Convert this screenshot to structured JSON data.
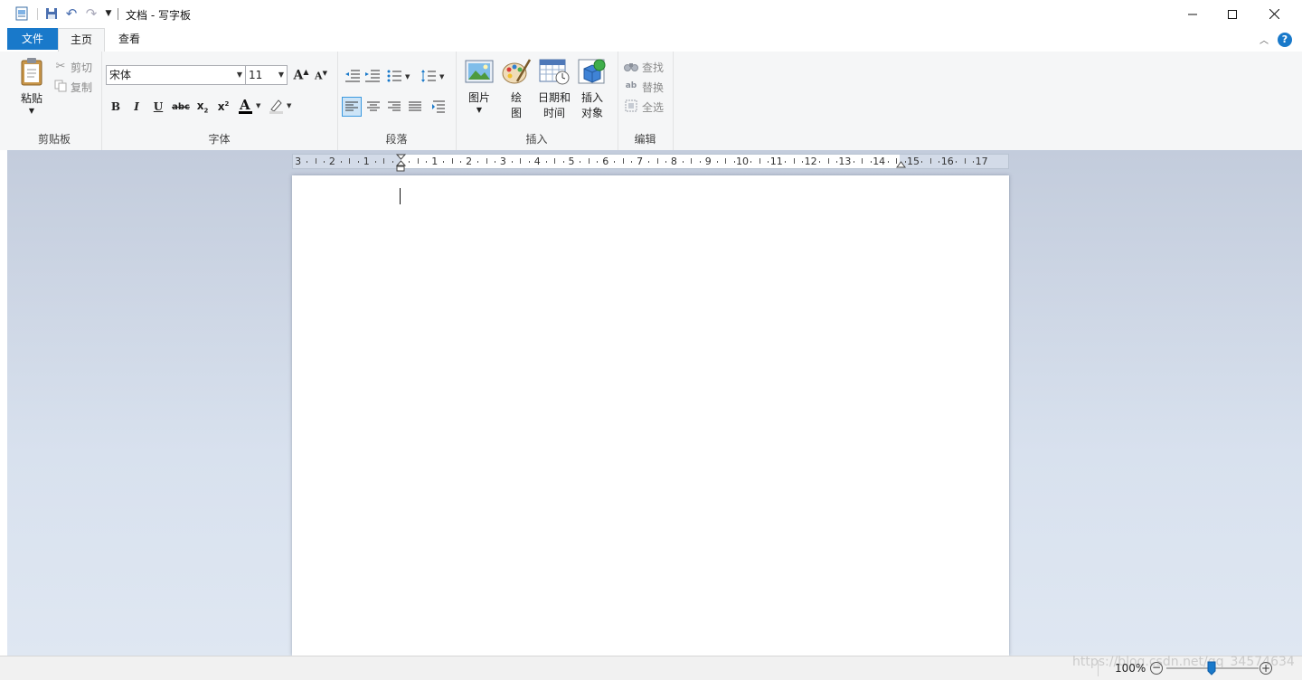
{
  "window": {
    "title": "文档 - 写字板"
  },
  "tabs": {
    "file": "文件",
    "home": "主页",
    "view": "查看"
  },
  "ribbon": {
    "clipboard": {
      "label": "剪贴板",
      "paste": "粘贴",
      "cut": "剪切",
      "copy": "复制"
    },
    "font": {
      "label": "字体",
      "family": "宋体",
      "size": "11"
    },
    "paragraph": {
      "label": "段落"
    },
    "insert": {
      "label": "插入",
      "picture": "图片",
      "paint_1": "绘",
      "paint_2": "图",
      "datetime_1": "日期和",
      "datetime_2": "时间",
      "object_1": "插入",
      "object_2": "对象"
    },
    "editing": {
      "label": "编辑",
      "find": "查找",
      "replace": "替换",
      "select_all": "全选"
    }
  },
  "ruler": {
    "left_numbers": [
      "3",
      "2",
      "1"
    ],
    "right_numbers": [
      "1",
      "2",
      "3",
      "4",
      "5",
      "6",
      "7",
      "8",
      "9",
      "10",
      "11",
      "12",
      "13",
      "14",
      "15",
      "16",
      "17"
    ]
  },
  "status": {
    "zoom": "100%",
    "watermark": "https://blog.csdn.net/qq_34574634"
  },
  "colors": {
    "file_tab": "#1979ca",
    "help": "#1979ca",
    "font_color_bar": "#000000"
  }
}
